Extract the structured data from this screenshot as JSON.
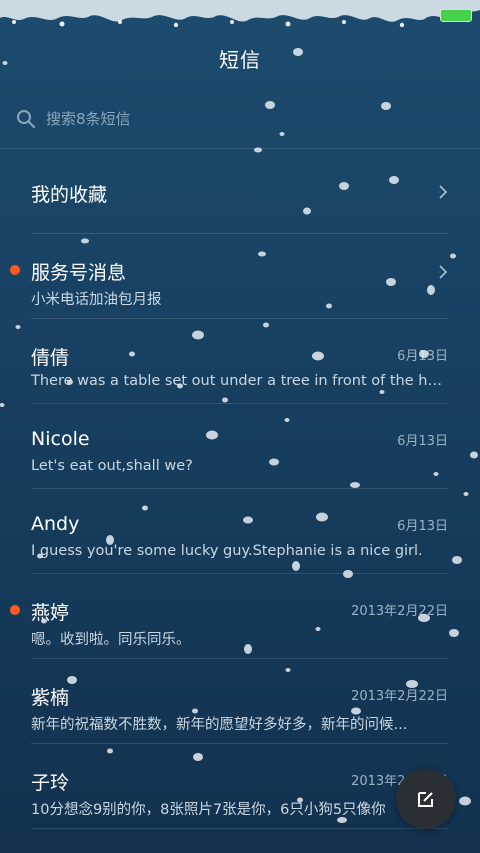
{
  "header": {
    "title": "短信"
  },
  "search": {
    "placeholder": "搜索8条短信"
  },
  "favorites": {
    "label": "我的收藏"
  },
  "conversations": [
    {
      "name": "服务号消息",
      "preview": "小米电话加油包月报",
      "date": "",
      "unread": true,
      "chevron": true
    },
    {
      "name": "倩倩",
      "preview": "There was a table set out under a tree in front of the ho...",
      "date": "6月13日",
      "unread": false,
      "chevron": false
    },
    {
      "name": "Nicole",
      "preview": "Let's eat out,shall we?",
      "date": "6月13日",
      "unread": false,
      "chevron": false
    },
    {
      "name": "Andy",
      "preview": "I guess you're some lucky guy.Stephanie is a nice girl.",
      "date": "6月13日",
      "unread": false,
      "chevron": false
    },
    {
      "name": "燕婷",
      "preview": "嗯。收到啦。同乐同乐。",
      "date": "2013年2月22日",
      "unread": true,
      "chevron": false
    },
    {
      "name": "紫楠",
      "preview": "新年的祝福数不胜数，新年的愿望好多好多，新年的问候...",
      "date": "2013年2月22日",
      "unread": false,
      "chevron": false
    },
    {
      "name": "子玲",
      "preview": "10分想念9别的你，8张照片7张是你，6只小狗5只像你",
      "date": "2013年2月22日",
      "unread": false,
      "chevron": false
    }
  ],
  "icons": {
    "search": "search-icon",
    "chevron": "chevron-right-icon",
    "compose": "compose-icon",
    "battery": "battery-icon"
  },
  "colors": {
    "unread_dot": "#ff5a1f",
    "battery": "#47d14a",
    "compose_bg": "#2a2f35"
  }
}
